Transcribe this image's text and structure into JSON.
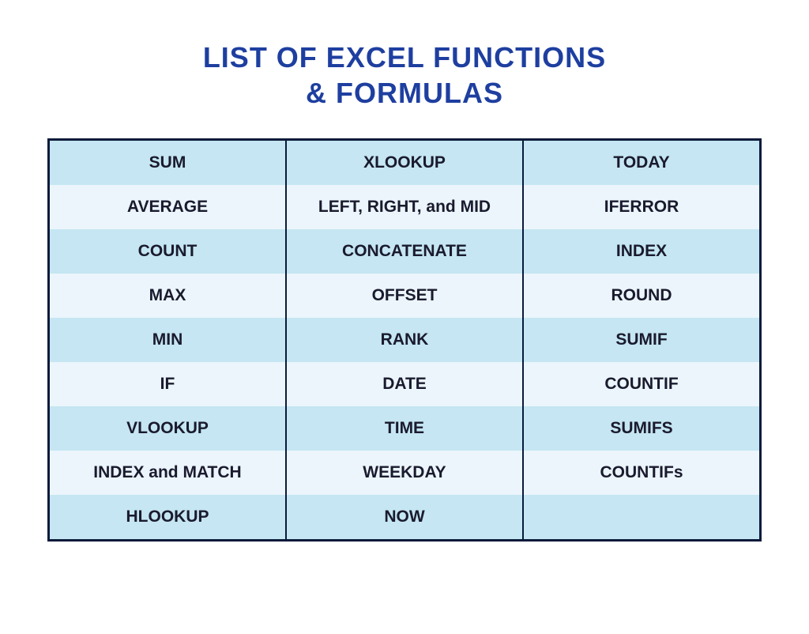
{
  "title_line1": "LIST OF EXCEL FUNCTIONS",
  "title_line2": "& FORMULAS",
  "table": {
    "rows": [
      {
        "col1": "SUM",
        "col2": "XLOOKUP",
        "col3": "TODAY"
      },
      {
        "col1": "AVERAGE",
        "col2": "LEFT, RIGHT, and MID",
        "col3": "IFERROR"
      },
      {
        "col1": "COUNT",
        "col2": "CONCATENATE",
        "col3": "INDEX"
      },
      {
        "col1": "MAX",
        "col2": "OFFSET",
        "col3": "ROUND"
      },
      {
        "col1": "MIN",
        "col2": "RANK",
        "col3": "SUMIF"
      },
      {
        "col1": "IF",
        "col2": "DATE",
        "col3": "COUNTIF"
      },
      {
        "col1": "VLOOKUP",
        "col2": "TIME",
        "col3": "SUMIFS"
      },
      {
        "col1": "INDEX and MATCH",
        "col2": "WEEKDAY",
        "col3": "COUNTIFs"
      },
      {
        "col1": "HLOOKUP",
        "col2": "NOW",
        "col3": ""
      }
    ]
  }
}
